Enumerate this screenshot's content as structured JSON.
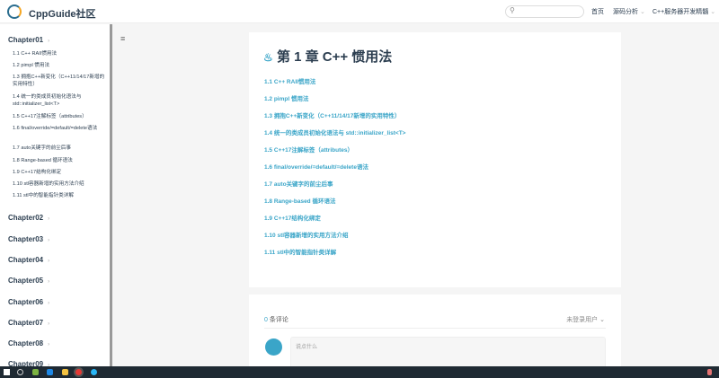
{
  "header": {
    "brand": "CppGuide社区",
    "search_placeholder": "",
    "nav": [
      "首页",
      "源码分析",
      "C++服务器开发精髓"
    ]
  },
  "sidebar": {
    "chapters": [
      "Chapter01",
      "Chapter02",
      "Chapter03",
      "Chapter04",
      "Chapter05",
      "Chapter06",
      "Chapter07",
      "Chapter08",
      "Chapter09"
    ],
    "items": [
      "1.1 C++ RAII惯用法",
      "1.2 pimpl 惯用法",
      "1.3 拥抱C++新变化（C++11/14/17新增的实用特性）",
      "1.4 统一的类成员初始化语法与 std::initializer_list<T>",
      "1.5 C++17注解标签（attributes）",
      "1.6 final/override/=default/=delete语法",
      "1.7 auto关键字的前尘后事",
      "1.8 Range-based 循环语法",
      "1.9 C++17结构化绑定",
      "1.10 stl容器新增的实用方法介绍",
      "1.11 stl中的智能指针类详解"
    ]
  },
  "main": {
    "title": "第 1 章 C++ 惯用法",
    "links": [
      "1.1 C++ RAII惯用法",
      "1.2 pimpl 惯用法",
      "1.3 拥抱C++新变化（C++11/14/17新增的实用特性）",
      "1.4 统一的类成员初始化语法与 std::initializer_list<T>",
      "1.5 C++17注解标签（attributes）",
      "1.6 final/override/=default/=delete语法",
      "1.7 auto关键字的前尘后事",
      "1.8 Range-based 循环语法",
      "1.9 C++17结构化绑定",
      "1.10 stl容器新增的实用方法介绍",
      "1.11 stl中的智能指针类详解"
    ]
  },
  "comments": {
    "count": "0",
    "label": "条评论",
    "user": "未登录用户",
    "placeholder": "说点什么"
  },
  "colors": {
    "accent": "#3aa5c8",
    "text": "#2c3e50"
  }
}
